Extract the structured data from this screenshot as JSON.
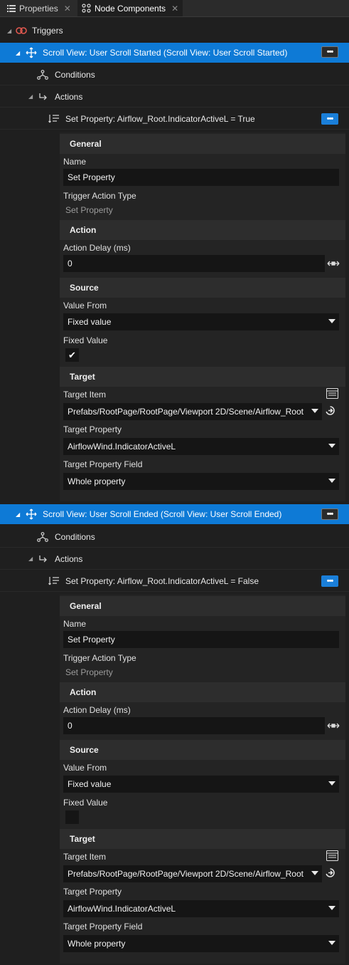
{
  "tabs": [
    {
      "label": "Properties",
      "icon": "list-icon",
      "close": "✕"
    },
    {
      "label": "Node Components",
      "icon": "node-components-icon",
      "close": "✕"
    }
  ],
  "triggers_label": "Triggers",
  "more_glyph": "•••",
  "blocks": [
    {
      "trigger_title": "Scroll View: User Scroll Started (Scroll View: User Scroll Started)",
      "conditions_label": "Conditions",
      "actions_label": "Actions",
      "action_title": "Set Property: Airflow_Root.IndicatorActiveL = True",
      "general_label": "General",
      "name_label": "Name",
      "name_value": "Set Property",
      "type_label": "Trigger Action Type",
      "type_value": "Set Property",
      "action_section_label": "Action",
      "delay_label": "Action Delay (ms)",
      "delay_value": "0",
      "source_label": "Source",
      "value_from_label": "Value From",
      "value_from_value": "Fixed value",
      "fixed_value_label": "Fixed Value",
      "fixed_value_checked": true,
      "check_glyph": "✔",
      "target_label": "Target",
      "target_item_label": "Target Item",
      "target_item_value": "Prefabs/RootPage/RootPage/Viewport 2D/Scene/Airflow_Root",
      "target_property_label": "Target Property",
      "target_property_value": "AirflowWind.IndicatorActiveL",
      "target_field_label": "Target Property Field",
      "target_field_value": "Whole property"
    },
    {
      "trigger_title": "Scroll View: User Scroll Ended (Scroll View: User Scroll Ended)",
      "conditions_label": "Conditions",
      "actions_label": "Actions",
      "action_title": "Set Property: Airflow_Root.IndicatorActiveL = False",
      "general_label": "General",
      "name_label": "Name",
      "name_value": "Set Property",
      "type_label": "Trigger Action Type",
      "type_value": "Set Property",
      "action_section_label": "Action",
      "delay_label": "Action Delay (ms)",
      "delay_value": "0",
      "source_label": "Source",
      "value_from_label": "Value From",
      "value_from_value": "Fixed value",
      "fixed_value_label": "Fixed Value",
      "fixed_value_checked": false,
      "check_glyph": "",
      "target_label": "Target",
      "target_item_label": "Target Item",
      "target_item_value": "Prefabs/RootPage/RootPage/Viewport 2D/Scene/Airflow_Root",
      "target_property_label": "Target Property",
      "target_property_value": "AirflowWind.IndicatorActiveL",
      "target_field_label": "Target Property Field",
      "target_field_value": "Whole property"
    }
  ]
}
